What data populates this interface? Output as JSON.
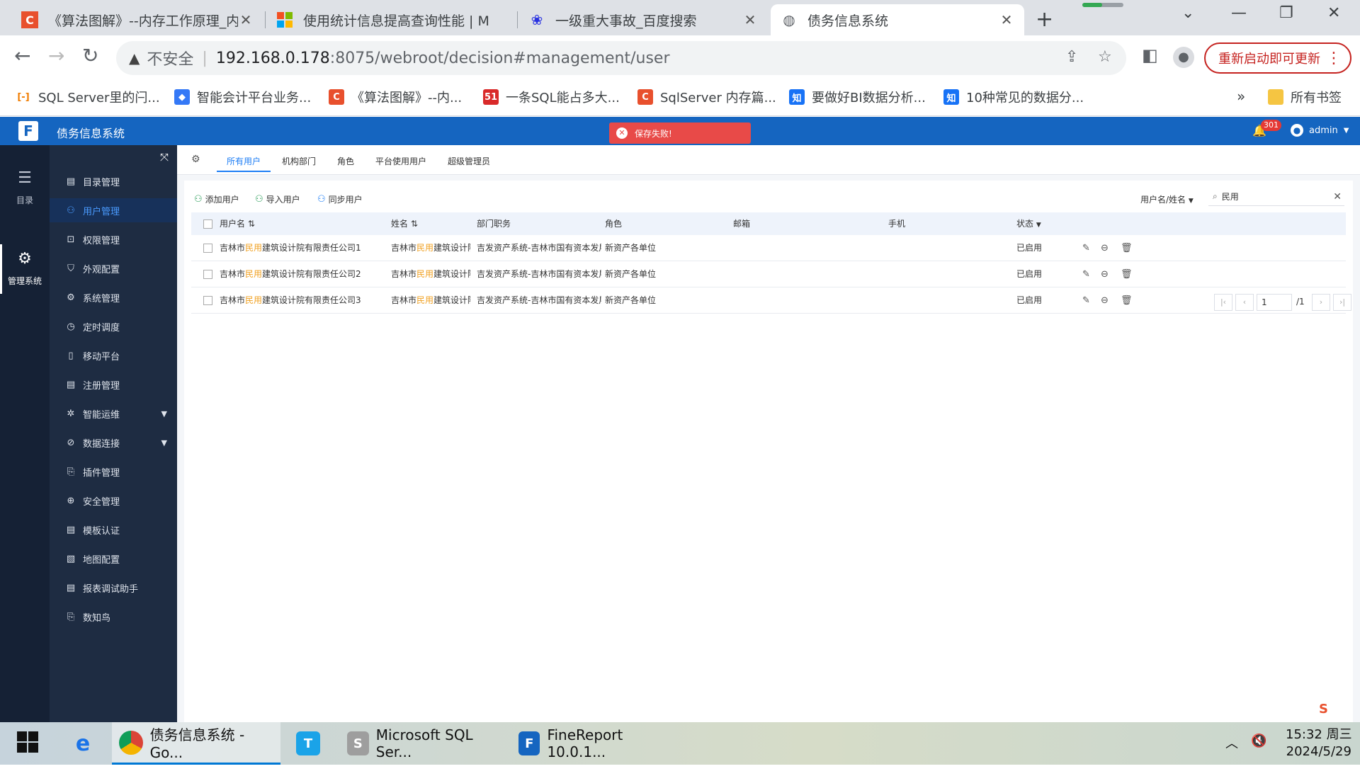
{
  "browser": {
    "tabs": [
      {
        "title": "《算法图解》--内存工作原理_内",
        "favicon": "C",
        "color": "#e8502d"
      },
      {
        "title": "使用统计信息提高查询性能 | Mi",
        "favicon": "ms",
        "color": "#f25022"
      },
      {
        "title": "一级重大事故_百度搜索",
        "favicon": "du",
        "color": "#2932e1"
      },
      {
        "title": "债务信息系统",
        "favicon": "globe",
        "color": "#5f6368"
      }
    ],
    "address": {
      "insecure_label": "不安全",
      "host": "192.168.0.178",
      "path": ":8075/webroot/decision#management/user"
    },
    "restart_label": "重新启动即可更新",
    "bookmarks": [
      {
        "label": "SQL Server里的闩...",
        "fav": "[-]",
        "color": "#f07c00"
      },
      {
        "label": "智能会计平台业务...",
        "fav": "◆",
        "color": "#3478f6"
      },
      {
        "label": "《算法图解》--内...",
        "fav": "C",
        "color": "#e8502d"
      },
      {
        "label": "一条SQL能占多大...",
        "fav": "51",
        "color": "#d92a2a"
      },
      {
        "label": "SqlServer 内存篇...",
        "fav": "C",
        "color": "#e8502d"
      },
      {
        "label": "要做好BI数据分析...",
        "fav": "知",
        "color": "#1772f6"
      },
      {
        "label": "10种常见的数据分...",
        "fav": "知",
        "color": "#1772f6"
      }
    ],
    "bookmarks_more": "»",
    "all_bookmarks": "所有书签"
  },
  "app": {
    "title": "债务信息系统",
    "toast": "保存失败!",
    "notify_count": "301",
    "user": "admin"
  },
  "rail": [
    {
      "label": "目录",
      "icon": "≡"
    },
    {
      "label": "管理系统",
      "icon": "⚙"
    }
  ],
  "sidebar": [
    {
      "label": "目录管理",
      "icon": "▤"
    },
    {
      "label": "用户管理",
      "icon": "👤"
    },
    {
      "label": "权限管理",
      "icon": "🔒"
    },
    {
      "label": "外观配置",
      "icon": "🖌"
    },
    {
      "label": "系统管理",
      "icon": "⚙"
    },
    {
      "label": "定时调度",
      "icon": "⏱"
    },
    {
      "label": "移动平台",
      "icon": "▯"
    },
    {
      "label": "注册管理",
      "icon": "▤"
    },
    {
      "label": "智能运维",
      "icon": "✲"
    },
    {
      "label": "数据连接",
      "icon": "⊘"
    },
    {
      "label": "插件管理",
      "icon": "✎"
    },
    {
      "label": "安全管理",
      "icon": "⊕"
    },
    {
      "label": "模板认证",
      "icon": "▤"
    },
    {
      "label": "地图配置",
      "icon": "▧"
    },
    {
      "label": "报表调试助手",
      "icon": "▤"
    },
    {
      "label": "数知鸟",
      "icon": "✎"
    }
  ],
  "content_tabs": [
    "所有用户",
    "机构部门",
    "角色",
    "平台使用用户",
    "超级管理员"
  ],
  "actions": [
    "添加用户",
    "导入用户",
    "同步用户"
  ],
  "filter": {
    "field": "用户名/姓名",
    "query": "民用"
  },
  "table": {
    "headers": [
      "用户名",
      "姓名",
      "部门职务",
      "角色",
      "邮箱",
      "手机",
      "状态"
    ],
    "rows": [
      {
        "username_pre": "吉林市",
        "username_hl": "民用",
        "username_post": "建筑设计院有限责任公司1",
        "name_pre": "吉林市",
        "name_hl": "民用",
        "name_post": "建筑设计院...",
        "dept": "吉发资产系统-吉林市国有资本发展控...",
        "role": "新资产各单位",
        "email": "",
        "phone": "",
        "status": "已启用"
      },
      {
        "username_pre": "吉林市",
        "username_hl": "民用",
        "username_post": "建筑设计院有限责任公司2",
        "name_pre": "吉林市",
        "name_hl": "民用",
        "name_post": "建筑设计院...",
        "dept": "吉发资产系统-吉林市国有资本发展控...",
        "role": "新资产各单位",
        "email": "",
        "phone": "",
        "status": "已启用"
      },
      {
        "username_pre": "吉林市",
        "username_hl": "民用",
        "username_post": "建筑设计院有限责任公司3",
        "name_pre": "吉林市",
        "name_hl": "民用",
        "name_post": "建筑设计院...",
        "dept": "吉发资产系统-吉林市国有资本发展控...",
        "role": "新资产各单位",
        "email": "",
        "phone": "",
        "status": "已启用"
      }
    ]
  },
  "pager": {
    "page": "1",
    "total": "/1"
  },
  "taskbar": {
    "items": [
      {
        "label": "债务信息系统 - Go...",
        "color": "#db4437",
        "icon": "G"
      },
      {
        "label": "",
        "color": "#1aa3e8",
        "icon": "T"
      },
      {
        "label": "Microsoft SQL Ser...",
        "color": "#a0a0a0",
        "icon": "S"
      },
      {
        "label": "FineReport 10.0.1...",
        "color": "#1565c0",
        "icon": "F"
      }
    ],
    "time": "15:32 周三",
    "date": "2024/5/29"
  }
}
